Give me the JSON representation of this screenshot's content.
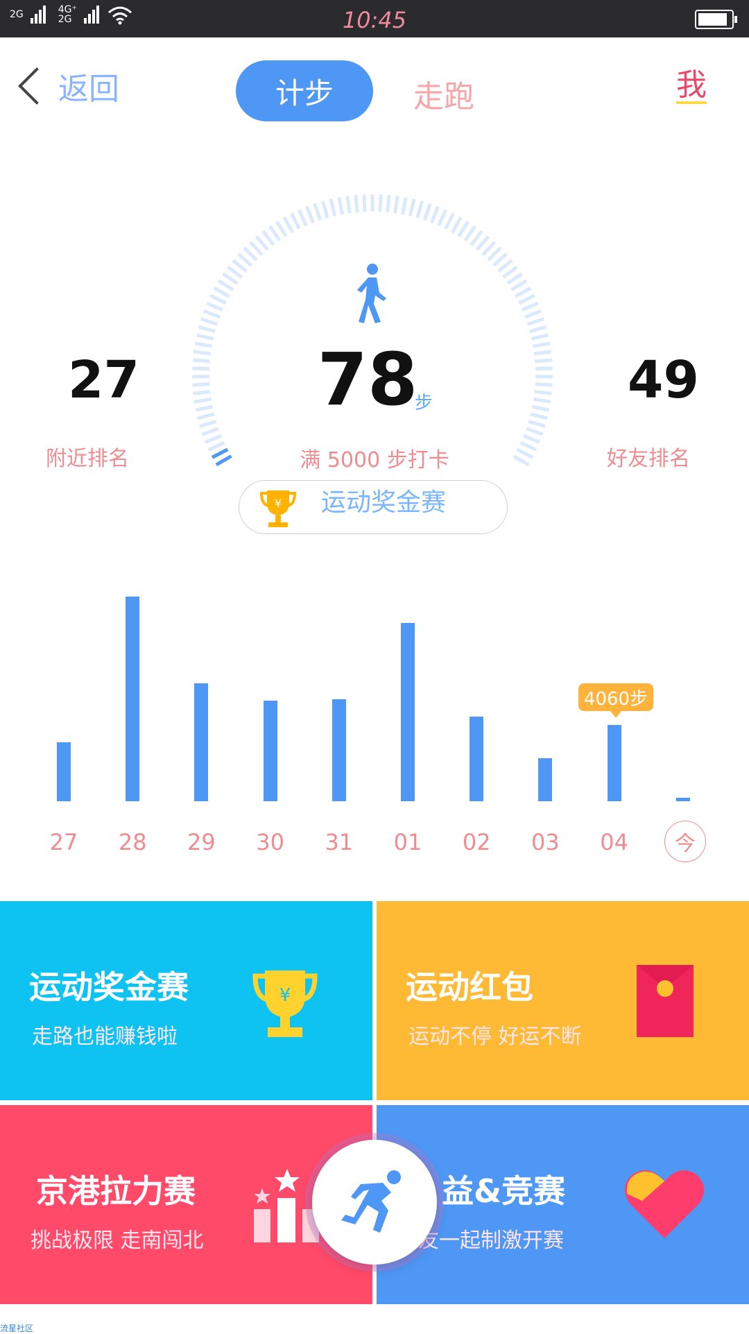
{
  "status_bar": {
    "left_net_1": "2G",
    "left_net_2": "4G⁺",
    "left_net_3": "2G",
    "time": "10:45",
    "battery_level_pct": 90
  },
  "header": {
    "back_label": "返回",
    "tab_active": "计步",
    "tab_other": "走跑",
    "profile_label": "我"
  },
  "summary": {
    "steps": "78",
    "steps_unit": "步",
    "goal_text": "满 5000 步打卡",
    "nearby_rank": "27",
    "nearby_rank_label": "附近排名",
    "friend_rank": "49",
    "friend_rank_label": "好友排名",
    "banner_text": "运动奖金赛",
    "gauge_progress_pct": 2
  },
  "chart_data": {
    "type": "bar",
    "categories": [
      "27",
      "28",
      "29",
      "30",
      "31",
      "01",
      "02",
      "03",
      "04",
      "今"
    ],
    "values": [
      1700,
      5900,
      3400,
      2900,
      2950,
      5150,
      2450,
      1250,
      2200,
      100
    ],
    "highlight": {
      "category": "04",
      "label": "4060步"
    },
    "colors": {
      "bar": "#4f97f5",
      "label": "#f08c90",
      "tooltip": "#ffb33b"
    }
  },
  "cards": [
    {
      "title": "运动奖金赛",
      "subtitle": "走路也能赚钱啦",
      "icon": "trophy-icon",
      "color": "#0ec3f2"
    },
    {
      "title": "运动红包",
      "subtitle": "运动不停 好运不断",
      "icon": "red-envelope-icon",
      "color": "#ffba35"
    },
    {
      "title": "京港拉力赛",
      "subtitle": "挑战极限 走南闯北",
      "icon": "podium-icon",
      "color": "#ff4a6a"
    },
    {
      "title": "益&竞赛",
      "subtitle": "友一起制激开赛",
      "icon": "heart-icon",
      "color": "#4f97f5"
    }
  ],
  "fab": {
    "icon": "runner-icon"
  },
  "footer": {
    "text": "流星社区"
  }
}
